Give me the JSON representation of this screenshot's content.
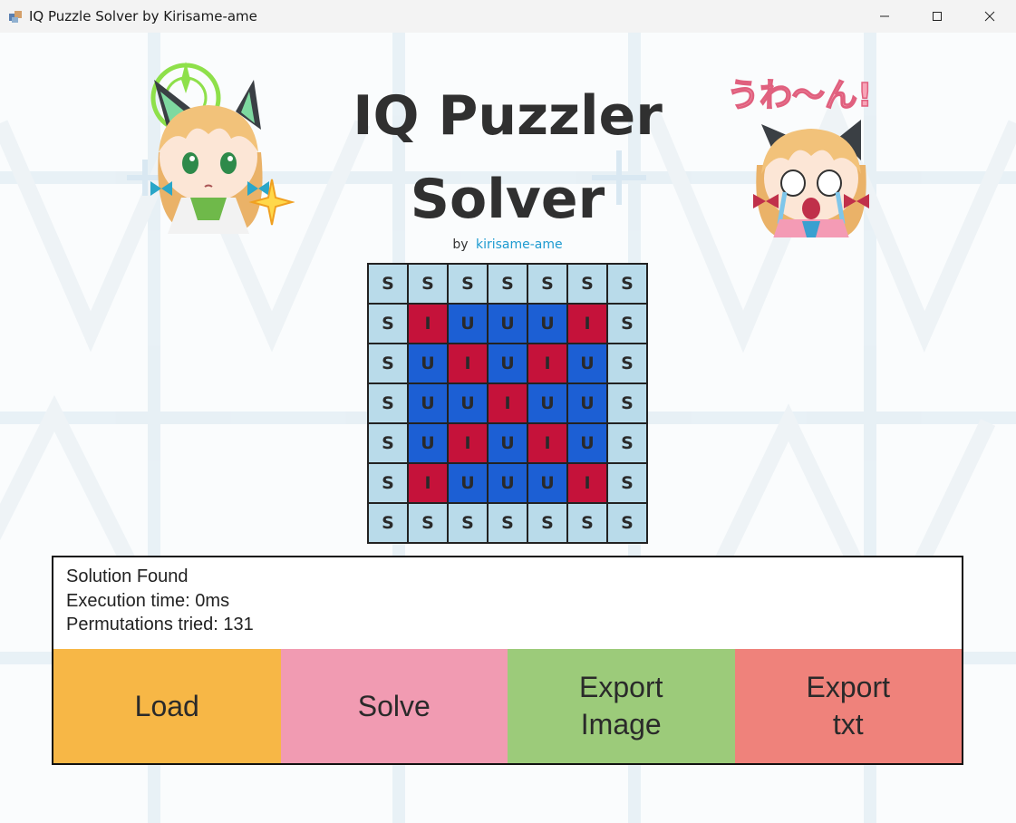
{
  "window": {
    "title": "IQ Puzzle Solver by Kirisame-ame"
  },
  "header": {
    "title_line1": "IQ Puzzler",
    "title_line2": "Solver",
    "by_label": "by",
    "author": "kirisame-ame"
  },
  "stickers": {
    "right_text": "うわ〜ん!"
  },
  "colors": {
    "S": "#b9dbea",
    "U": "#1c5fd4",
    "I": "#c5123a"
  },
  "grid": {
    "rows": [
      [
        "S",
        "S",
        "S",
        "S",
        "S",
        "S",
        "S"
      ],
      [
        "S",
        "I",
        "U",
        "U",
        "U",
        "I",
        "S"
      ],
      [
        "S",
        "U",
        "I",
        "U",
        "I",
        "U",
        "S"
      ],
      [
        "S",
        "U",
        "U",
        "I",
        "U",
        "U",
        "S"
      ],
      [
        "S",
        "U",
        "I",
        "U",
        "I",
        "U",
        "S"
      ],
      [
        "S",
        "I",
        "U",
        "U",
        "U",
        "I",
        "S"
      ],
      [
        "S",
        "S",
        "S",
        "S",
        "S",
        "S",
        "S"
      ]
    ]
  },
  "status": {
    "line1": "Solution Found",
    "line2": "Execution time: 0ms",
    "line3": "Permutations tried: 131"
  },
  "buttons": [
    {
      "label": "Load",
      "color": "#f7b746"
    },
    {
      "label": "Solve",
      "color": "#f19bb2"
    },
    {
      "label": "Export\nImage",
      "color": "#9ccb7a"
    },
    {
      "label": "Export\n txt",
      "color": "#ef827b"
    }
  ]
}
